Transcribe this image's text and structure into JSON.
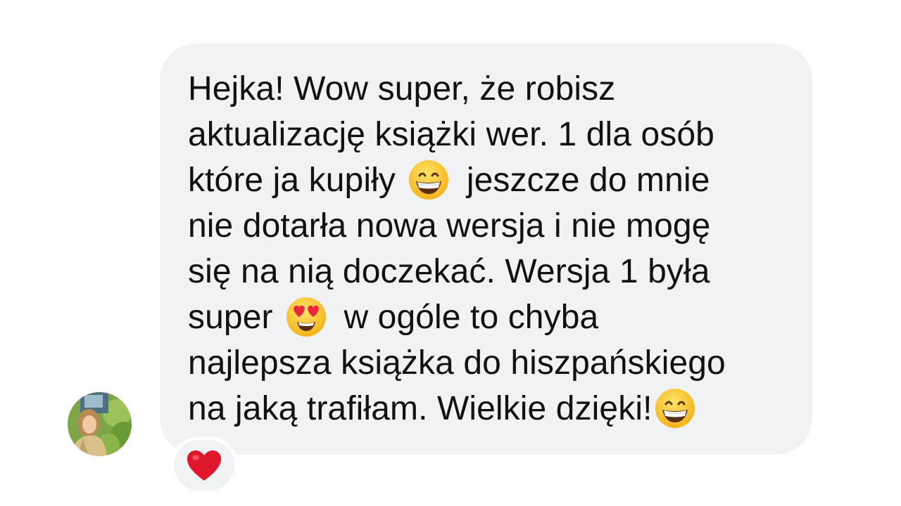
{
  "message": {
    "lines": [
      [
        "Hejka! Wow super, że robisz"
      ],
      [
        "aktualizację książki wer. 1 dla osób"
      ],
      [
        "które ja kupiły",
        "jeszcze do mnie"
      ],
      [
        "nie dotarła nowa wersja i nie mogę"
      ],
      [
        "się na nią doczekać. Wersja 1 była"
      ],
      [
        "super",
        "w ogóle to chyba"
      ],
      [
        "najlepsza książka do hiszpańskiego"
      ],
      [
        "na jaką trafiłam. Wielkie dzięki!"
      ]
    ],
    "emojis": [
      "grinning-face-icon",
      "heart-eyes-icon",
      "grinning-face-icon"
    ]
  },
  "reaction": {
    "emoji": "red-heart-icon",
    "color": "#e0162b"
  },
  "colors": {
    "bubble": "#f1f2f4",
    "text": "#111111",
    "background": "#ffffff"
  }
}
